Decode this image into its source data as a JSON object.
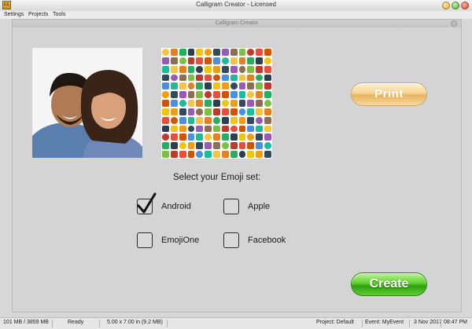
{
  "window": {
    "title": "Calligram Creator - Licensed",
    "app_icon_text": "CC"
  },
  "menu": {
    "items": [
      "Settings",
      "Projects",
      "Tools"
    ]
  },
  "panel": {
    "title": "Calligram Creator"
  },
  "buttons": {
    "print_label": "Print",
    "create_label": "Create"
  },
  "emoji_set": {
    "prompt": "Select your Emoji set:",
    "options": [
      {
        "label": "Android",
        "checked": true
      },
      {
        "label": "Apple",
        "checked": false
      },
      {
        "label": "EmojiOne",
        "checked": false
      },
      {
        "label": "Facebook",
        "checked": false
      }
    ]
  },
  "status": {
    "memory": "101 MB / 3859 MB",
    "state": "Ready",
    "page_size": "5.00 x 7.00 in  (9.2 MB)",
    "project": "Project: Default",
    "event": "Event: MyEvent",
    "date": "3 Nov 2017",
    "time": "08:47 PM"
  },
  "colors": {
    "print_accent": "#f6d491",
    "create_accent": "#3faa17",
    "emoji_palette": [
      "#f5c542",
      "#4a90e2",
      "#e94e3c",
      "#7bc043",
      "#9b59b6",
      "#f39c12",
      "#2c3e50",
      "#e67e22",
      "#1abc9c",
      "#d35400",
      "#c0392b",
      "#8e6e53",
      "#34495e",
      "#f1c40f",
      "#27ae60"
    ]
  }
}
